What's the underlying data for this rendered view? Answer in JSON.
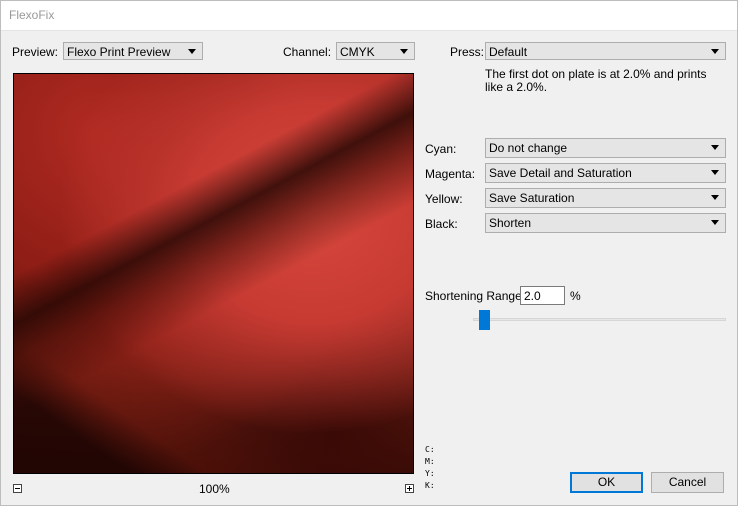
{
  "window": {
    "title": "FlexoFix"
  },
  "preview": {
    "label": "Preview:",
    "value": "Flexo Print Preview",
    "zoom": "100%"
  },
  "channel": {
    "label": "Channel:",
    "value": "CMYK"
  },
  "press": {
    "label": "Press:",
    "value": "Default",
    "description": "The first dot on plate is at 2.0% and prints like a 2.0%."
  },
  "inks": [
    {
      "label": "Cyan:",
      "value": "Do not change"
    },
    {
      "label": "Magenta:",
      "value": "Save Detail and Saturation"
    },
    {
      "label": "Yellow:",
      "value": "Save Saturation"
    },
    {
      "label": "Black:",
      "value": "Shorten"
    }
  ],
  "shortening": {
    "label": "Shortening Range:",
    "value": "2.0",
    "unit": "%",
    "slider_value": 2.0
  },
  "readout": {
    "c": "C:",
    "m": "M:",
    "y": "Y:",
    "k": "K:"
  },
  "buttons": {
    "ok": "OK",
    "cancel": "Cancel"
  }
}
